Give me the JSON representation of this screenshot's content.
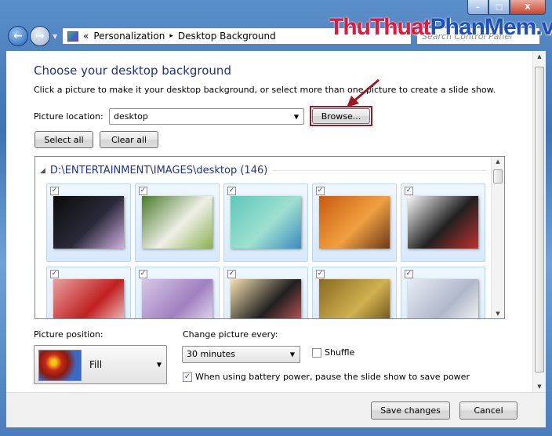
{
  "window": {
    "minimize": "–",
    "maximize": "□",
    "close": "X"
  },
  "address": {
    "prefix": "«",
    "path": [
      "Personalization",
      "Desktop Background"
    ],
    "separator": "▸"
  },
  "search": {
    "placeholder": "Search Control Panel"
  },
  "watermark": {
    "part1": "ThuThuat",
    "part2": "PhanMem",
    "part3": ".vn"
  },
  "main": {
    "title": "Choose your desktop background",
    "description": "Click a picture to make it your desktop background, or select more than one picture to create a slide show.",
    "picture_location_label": "Picture location:",
    "picture_location_value": "desktop",
    "browse_label": "Browse...",
    "select_all_label": "Select all",
    "clear_all_label": "Clear all",
    "gallery": {
      "folder": "D:\\ENTERTAINMENT\\IMAGES\\desktop (146)",
      "thumbnails": [
        {
          "checked": true,
          "colors": [
            "#0a0a0a",
            "#2a2a3a",
            "#d0b0e0"
          ]
        },
        {
          "checked": true,
          "colors": [
            "#4a7a2a",
            "#f0f0e8",
            "#8ab050"
          ]
        },
        {
          "checked": true,
          "colors": [
            "#5ec8b8",
            "#9fe0d0",
            "#3a8ac0"
          ]
        },
        {
          "checked": true,
          "colors": [
            "#c85a10",
            "#f0a040",
            "#6a3a1a"
          ]
        },
        {
          "checked": true,
          "colors": [
            "#f8f8f8",
            "#202020",
            "#c03030"
          ]
        },
        {
          "checked": true,
          "colors": [
            "#e8a0a0",
            "#c02020",
            "#f8e0e0"
          ]
        },
        {
          "checked": true,
          "colors": [
            "#d8c8e8",
            "#a080c0",
            "#f0e8f8"
          ]
        },
        {
          "checked": true,
          "colors": [
            "#f4e0b0",
            "#202020",
            "#e06060"
          ]
        },
        {
          "checked": true,
          "colors": [
            "#8a6a20",
            "#d0b050",
            "#5a4010"
          ]
        },
        {
          "checked": true,
          "colors": [
            "#e8ecf4",
            "#b0b8c8",
            "#ffffff"
          ]
        }
      ]
    },
    "picture_position_label": "Picture position:",
    "picture_position_value": "Fill",
    "change_every_label": "Change picture every:",
    "change_every_value": "30 minutes",
    "shuffle_label": "Shuffle",
    "shuffle_checked": false,
    "battery_label": "When using battery power, pause the slide show to save power",
    "battery_checked": true
  },
  "footer": {
    "save_label": "Save changes",
    "cancel_label": "Cancel"
  },
  "colors": {
    "title": "#1e3287",
    "highlight": "#9b1b25"
  }
}
